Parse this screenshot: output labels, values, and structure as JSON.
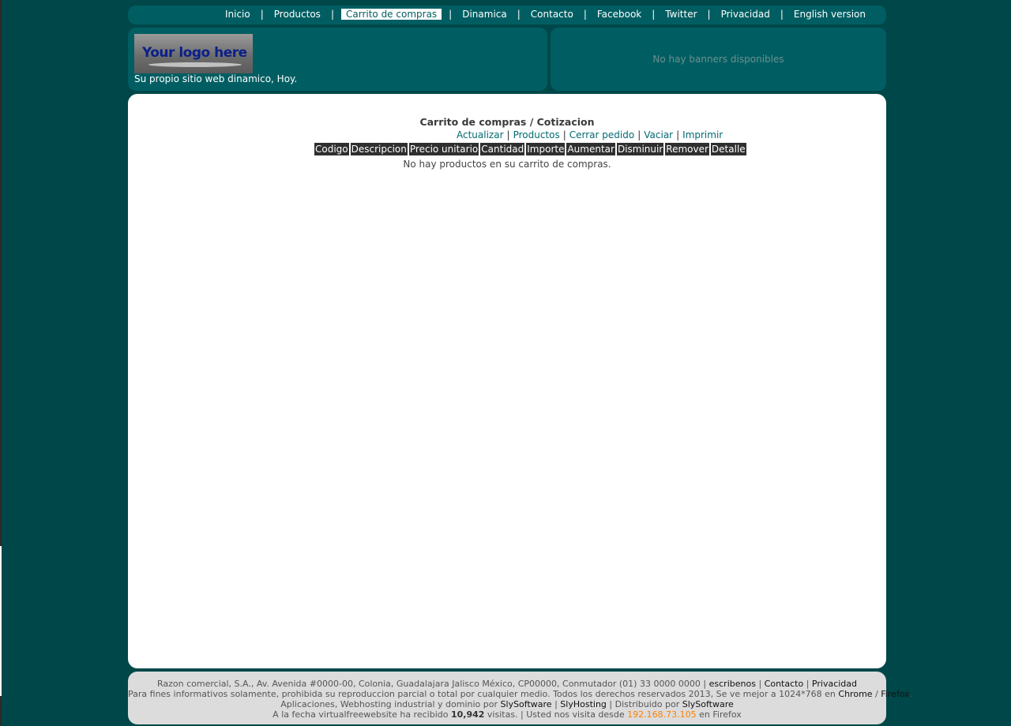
{
  "nav": {
    "items": [
      {
        "label": "Inicio",
        "active": false
      },
      {
        "label": "Productos",
        "active": false
      },
      {
        "label": "Carrito de compras",
        "active": true
      },
      {
        "label": "Dinamica",
        "active": false
      },
      {
        "label": "Contacto",
        "active": false
      },
      {
        "label": "Facebook",
        "active": false
      },
      {
        "label": "Twitter",
        "active": false
      },
      {
        "label": "Privacidad",
        "active": false
      },
      {
        "label": "English version",
        "active": false
      }
    ],
    "separator": "|"
  },
  "header": {
    "logo_text": "Your logo here",
    "tagline": "Su propio sitio web dinamico, Hoy.",
    "banner_text": "No hay banners disponibles"
  },
  "cart": {
    "title": "Carrito de compras / Cotizacion",
    "actions": [
      "Actualizar",
      "Productos",
      "Cerrar pedido",
      "Vaciar",
      "Imprimir"
    ],
    "columns": [
      "Codigo",
      "Descripcion",
      "Precio unitario",
      "Cantidad",
      "Importe",
      "Aumentar",
      "Disminuir",
      "Remover",
      "Detalle"
    ],
    "empty_message": "No hay productos en su carrito de compras."
  },
  "footer": {
    "line1": {
      "text": "Razon comercial, S.A., Av. Avenida #0000-00, Colonia, Guadalajara Jalisco México, CP00000, Conmutador (01) 33 0000 0000 |",
      "link_escribenos": "escribenos",
      "link_contacto": "Contacto",
      "link_privacidad": "Privacidad"
    },
    "line2": {
      "text": "Para fines informativos solamente, prohibida su reproduccion parcial o total por cualquier medio. Todos los derechos reservados 2013, Se ve mejor a 1024*768 en",
      "link_chrome": "Chrome",
      "link_firefox": "Firefox"
    },
    "line3": {
      "text": "Aplicaciones, Webhosting industrial y dominio por",
      "link_sly1": "SlySoftware",
      "link_hosting": "SlyHosting",
      "distrib": "Distribuido por",
      "link_sly2": "SlySoftware"
    },
    "line4": {
      "prefix": "A la fecha virtualfreewebsite ha recibido",
      "visits": "10,942",
      "middle": "visitas. | Usted nos visita desde",
      "ip": "192.168.73.105",
      "suffix": "en Firefox"
    }
  },
  "colors": {
    "page_bg": "#004749",
    "panel_bg": "#005e62",
    "content_bg": "#ffffff",
    "footer_bg": "#dcdcdc",
    "link": "#006a70",
    "header_cell_bg": "#2f2f2f",
    "ip_color": "#ff7f00"
  }
}
